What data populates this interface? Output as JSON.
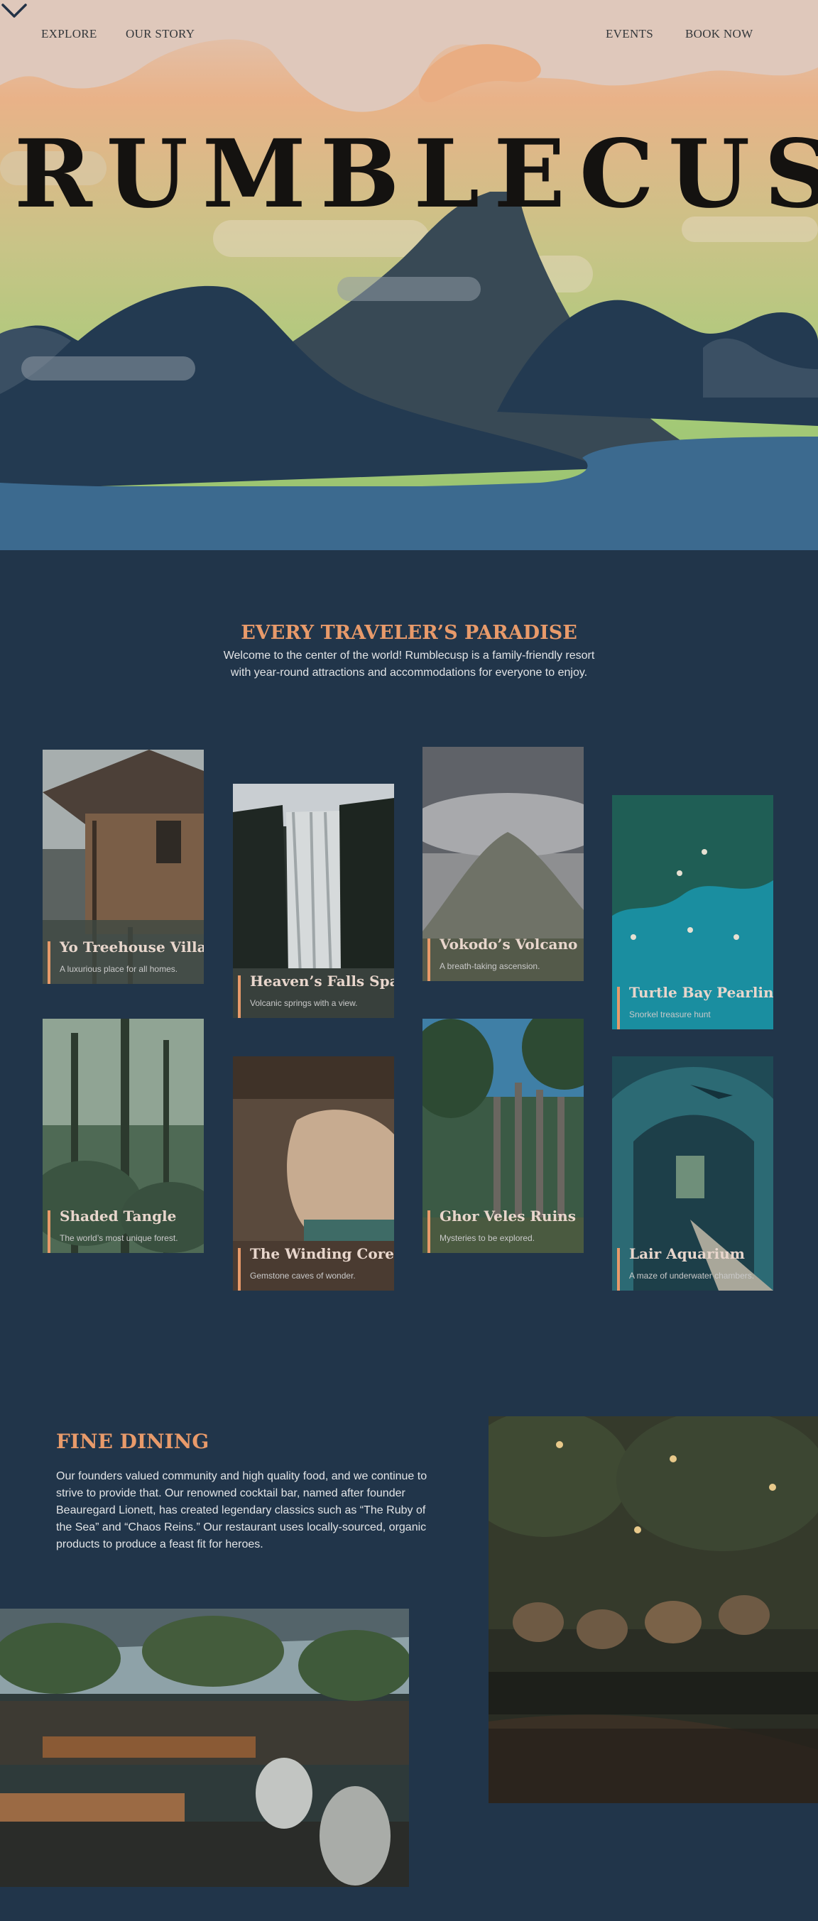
{
  "nav": {
    "explore": "EXPLORE",
    "our_story": "OUR STORY",
    "events": "EVENTS",
    "book_now": "BOOK NOW"
  },
  "hero": {
    "title": "RUMBLECUSP"
  },
  "intro": {
    "heading": "EVERY TRAVELER’S PARADISE",
    "line1": "Welcome to the center of the world! Rumblecusp is a family-friendly resort",
    "line2": "with year-round attractions and accommodations for everyone to enjoy."
  },
  "attractions": [
    {
      "title": "Yo Treehouse Villas",
      "subtitle": "A luxurious place for all homes."
    },
    {
      "title": "Heaven’s Falls Spa",
      "subtitle": "Volcanic springs with a view."
    },
    {
      "title": "Vokodo’s Volcano",
      "subtitle": "A breath-taking ascension."
    },
    {
      "title": "Turtle Bay Pearling",
      "subtitle": "Snorkel treasure hunt"
    },
    {
      "title": "Shaded Tangle",
      "subtitle": "The world’s most unique forest."
    },
    {
      "title": "The Winding Core",
      "subtitle": "Gemstone caves of wonder."
    },
    {
      "title": "Ghor Veles Ruins",
      "subtitle": "Mysteries to be explored."
    },
    {
      "title": "Lair Aquarium",
      "subtitle": "A maze of underwater chambers."
    }
  ],
  "dining": {
    "heading": "FINE DINING",
    "line1": "Our founders valued community and high quality food, and we continue to",
    "line2": "strive to provide that. Our renowned cocktail bar, named after founder",
    "line3": "Beauregard Lionett, has created legendary classics such as “The Ruby of",
    "line4": "the Sea” and “Chaos Reins.” Our restaurant uses locally-sourced, organic",
    "line5": "products to produce a feast fit for heroes."
  },
  "colors": {
    "background": "#21354a",
    "accent": "#e89a6a",
    "sky_top": "#dfc8bb",
    "sky_bottom": "#a8c97e",
    "water": "#3c6a8f"
  }
}
